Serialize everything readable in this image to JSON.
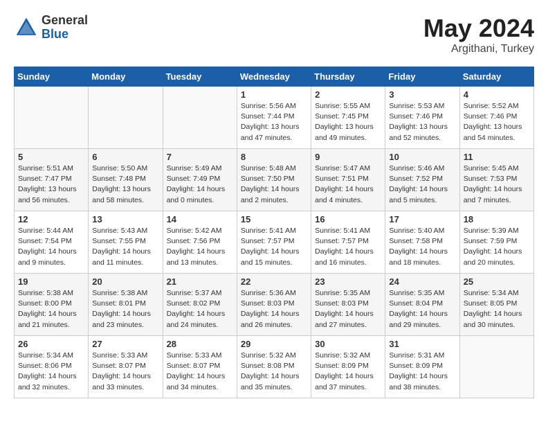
{
  "header": {
    "logo_general": "General",
    "logo_blue": "Blue",
    "title": "May 2024",
    "location": "Argithani, Turkey"
  },
  "weekdays": [
    "Sunday",
    "Monday",
    "Tuesday",
    "Wednesday",
    "Thursday",
    "Friday",
    "Saturday"
  ],
  "weeks": [
    [
      {
        "day": "",
        "info": ""
      },
      {
        "day": "",
        "info": ""
      },
      {
        "day": "",
        "info": ""
      },
      {
        "day": "1",
        "info": "Sunrise: 5:56 AM\nSunset: 7:44 PM\nDaylight: 13 hours\nand 47 minutes."
      },
      {
        "day": "2",
        "info": "Sunrise: 5:55 AM\nSunset: 7:45 PM\nDaylight: 13 hours\nand 49 minutes."
      },
      {
        "day": "3",
        "info": "Sunrise: 5:53 AM\nSunset: 7:46 PM\nDaylight: 13 hours\nand 52 minutes."
      },
      {
        "day": "4",
        "info": "Sunrise: 5:52 AM\nSunset: 7:46 PM\nDaylight: 13 hours\nand 54 minutes."
      }
    ],
    [
      {
        "day": "5",
        "info": "Sunrise: 5:51 AM\nSunset: 7:47 PM\nDaylight: 13 hours\nand 56 minutes."
      },
      {
        "day": "6",
        "info": "Sunrise: 5:50 AM\nSunset: 7:48 PM\nDaylight: 13 hours\nand 58 minutes."
      },
      {
        "day": "7",
        "info": "Sunrise: 5:49 AM\nSunset: 7:49 PM\nDaylight: 14 hours\nand 0 minutes."
      },
      {
        "day": "8",
        "info": "Sunrise: 5:48 AM\nSunset: 7:50 PM\nDaylight: 14 hours\nand 2 minutes."
      },
      {
        "day": "9",
        "info": "Sunrise: 5:47 AM\nSunset: 7:51 PM\nDaylight: 14 hours\nand 4 minutes."
      },
      {
        "day": "10",
        "info": "Sunrise: 5:46 AM\nSunset: 7:52 PM\nDaylight: 14 hours\nand 5 minutes."
      },
      {
        "day": "11",
        "info": "Sunrise: 5:45 AM\nSunset: 7:53 PM\nDaylight: 14 hours\nand 7 minutes."
      }
    ],
    [
      {
        "day": "12",
        "info": "Sunrise: 5:44 AM\nSunset: 7:54 PM\nDaylight: 14 hours\nand 9 minutes."
      },
      {
        "day": "13",
        "info": "Sunrise: 5:43 AM\nSunset: 7:55 PM\nDaylight: 14 hours\nand 11 minutes."
      },
      {
        "day": "14",
        "info": "Sunrise: 5:42 AM\nSunset: 7:56 PM\nDaylight: 14 hours\nand 13 minutes."
      },
      {
        "day": "15",
        "info": "Sunrise: 5:41 AM\nSunset: 7:57 PM\nDaylight: 14 hours\nand 15 minutes."
      },
      {
        "day": "16",
        "info": "Sunrise: 5:41 AM\nSunset: 7:57 PM\nDaylight: 14 hours\nand 16 minutes."
      },
      {
        "day": "17",
        "info": "Sunrise: 5:40 AM\nSunset: 7:58 PM\nDaylight: 14 hours\nand 18 minutes."
      },
      {
        "day": "18",
        "info": "Sunrise: 5:39 AM\nSunset: 7:59 PM\nDaylight: 14 hours\nand 20 minutes."
      }
    ],
    [
      {
        "day": "19",
        "info": "Sunrise: 5:38 AM\nSunset: 8:00 PM\nDaylight: 14 hours\nand 21 minutes."
      },
      {
        "day": "20",
        "info": "Sunrise: 5:38 AM\nSunset: 8:01 PM\nDaylight: 14 hours\nand 23 minutes."
      },
      {
        "day": "21",
        "info": "Sunrise: 5:37 AM\nSunset: 8:02 PM\nDaylight: 14 hours\nand 24 minutes."
      },
      {
        "day": "22",
        "info": "Sunrise: 5:36 AM\nSunset: 8:03 PM\nDaylight: 14 hours\nand 26 minutes."
      },
      {
        "day": "23",
        "info": "Sunrise: 5:35 AM\nSunset: 8:03 PM\nDaylight: 14 hours\nand 27 minutes."
      },
      {
        "day": "24",
        "info": "Sunrise: 5:35 AM\nSunset: 8:04 PM\nDaylight: 14 hours\nand 29 minutes."
      },
      {
        "day": "25",
        "info": "Sunrise: 5:34 AM\nSunset: 8:05 PM\nDaylight: 14 hours\nand 30 minutes."
      }
    ],
    [
      {
        "day": "26",
        "info": "Sunrise: 5:34 AM\nSunset: 8:06 PM\nDaylight: 14 hours\nand 32 minutes."
      },
      {
        "day": "27",
        "info": "Sunrise: 5:33 AM\nSunset: 8:07 PM\nDaylight: 14 hours\nand 33 minutes."
      },
      {
        "day": "28",
        "info": "Sunrise: 5:33 AM\nSunset: 8:07 PM\nDaylight: 14 hours\nand 34 minutes."
      },
      {
        "day": "29",
        "info": "Sunrise: 5:32 AM\nSunset: 8:08 PM\nDaylight: 14 hours\nand 35 minutes."
      },
      {
        "day": "30",
        "info": "Sunrise: 5:32 AM\nSunset: 8:09 PM\nDaylight: 14 hours\nand 37 minutes."
      },
      {
        "day": "31",
        "info": "Sunrise: 5:31 AM\nSunset: 8:09 PM\nDaylight: 14 hours\nand 38 minutes."
      },
      {
        "day": "",
        "info": ""
      }
    ]
  ]
}
